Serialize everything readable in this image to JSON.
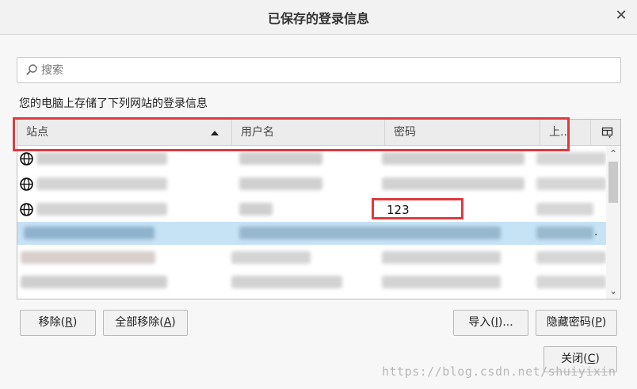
{
  "window": {
    "title": "已保存的登录信息",
    "close_glyph": "✕"
  },
  "search": {
    "placeholder": "搜索",
    "value": ""
  },
  "description": "您的电脑上存储了下列网站的登录信息",
  "table": {
    "columns": [
      {
        "label": "站点",
        "sorted": "ascending"
      },
      {
        "label": "用户名"
      },
      {
        "label": "密码"
      },
      {
        "label": "上.."
      }
    ],
    "column_picker_icon": "column-picker-icon",
    "rows": [
      {
        "site": "",
        "username": "",
        "password": "",
        "last_used": "",
        "icon": "globe-icon",
        "selected": false
      },
      {
        "site": "",
        "username": "",
        "password": "",
        "last_used": "",
        "icon": "globe-icon",
        "selected": false
      },
      {
        "site": "",
        "username": "",
        "password": "123",
        "last_used": "",
        "icon": "globe-icon",
        "selected": false
      },
      {
        "site": "",
        "username": "",
        "password": "",
        "last_used": ".",
        "icon": "",
        "selected": true
      },
      {
        "site": "",
        "username": "",
        "password": "",
        "last_used": "",
        "icon": "",
        "selected": false
      },
      {
        "site": "",
        "username": "",
        "password": "",
        "last_used": "",
        "icon": "",
        "selected": false
      }
    ]
  },
  "buttons": {
    "remove": {
      "label": "移除(",
      "key": "R",
      "suffix": ")"
    },
    "remove_all": {
      "label": "全部移除(",
      "key": "A",
      "suffix": ")"
    },
    "import": {
      "label": "导入(",
      "key": "I",
      "suffix": ")..."
    },
    "hide_passwords": {
      "label": "隐藏密码(",
      "key": "P",
      "suffix": ")"
    },
    "close": {
      "label": "关闭(",
      "key": "C",
      "suffix": ")"
    }
  },
  "watermark": "https://blog.csdn.net/shuiyixin",
  "colors": {
    "highlight": "#e0393f",
    "selected_row": "#c6e2f5"
  }
}
